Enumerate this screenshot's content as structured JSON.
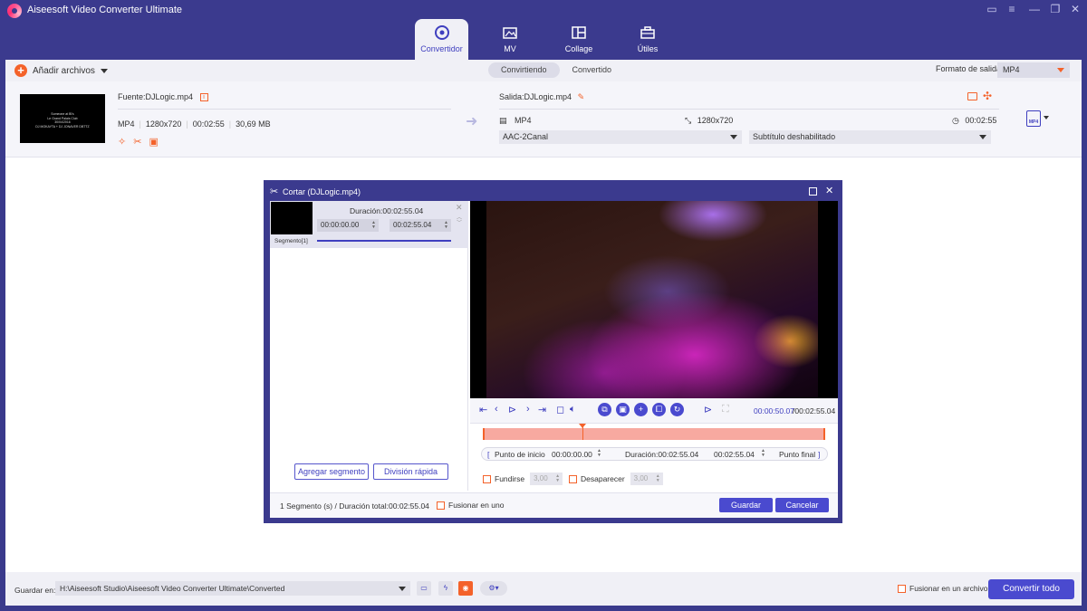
{
  "app": {
    "title": "Aiseesoft Video Converter Ultimate",
    "accent": "#4a4acf",
    "orange": "#f4622a"
  },
  "window_controls": [
    "chat-icon",
    "menu-icon",
    "minimize-icon",
    "maximize-icon",
    "close-icon"
  ],
  "nav_tabs": [
    {
      "label": "Convertidor",
      "icon": "convert-icon",
      "active": true
    },
    {
      "label": "MV",
      "icon": "mv-icon",
      "active": false
    },
    {
      "label": "Collage",
      "icon": "collage-icon",
      "active": false
    },
    {
      "label": "Útiles",
      "icon": "toolbox-icon",
      "active": false
    }
  ],
  "toolbar": {
    "add_files": "Añadir archivos",
    "subtabs": [
      "Convirtiendo",
      "Convertido"
    ],
    "output_format_label": "Formato de salida:",
    "output_format_value": "MP4"
  },
  "file": {
    "thumb_lines": [
      "Someone at Bl's",
      "Le Grand Palais Club",
      "30/04/2016",
      "DJ MOKAYTA + DJ JONAVER DBTTZ"
    ],
    "source_name": "Fuente:DJLogic.mp4",
    "source_format": "MP4",
    "source_resolution": "1280x720",
    "source_duration": "00:02:55",
    "source_size": "30,69 MB",
    "output_name": "Salida:DJLogic.mp4",
    "output_format": "MP4",
    "output_resolution": "1280x720",
    "output_duration": "00:02:55",
    "audio": "AAC-2Canal",
    "subtitle": "Subtítulo deshabilitado",
    "format_badge": "MP4"
  },
  "cut_dialog": {
    "title": "Cortar (DJLogic.mp4)",
    "segment": {
      "duration": "Duración:00:02:55.04",
      "start": "00:00:00.00",
      "end": "00:02:55.04",
      "label": "Segmento[1]"
    },
    "add_segment": "Agregar segmento",
    "quick_split": "División rápida",
    "time_current": "00:00:50.07",
    "time_total": "/00:02:55.04",
    "start_point_label": "Punto de inicio",
    "start_point": "00:00:00.00",
    "range_duration": "Duración:00:02:55.04",
    "end_point": "00:02:55.04",
    "end_point_label": "Punto final",
    "fade_in_label": "Fundirse",
    "fade_in_value": "3,00",
    "fade_out_label": "Desaparecer",
    "fade_out_value": "3,00",
    "summary": "1 Segmento (s) / Duración total:00:02:55.04",
    "merge_label": "Fusionar en uno",
    "save": "Guardar",
    "cancel": "Cancelar"
  },
  "bottom": {
    "save_to": "Guardar en:",
    "path": "H:\\Aiseesoft Studio\\Aiseesoft Video Converter Ultimate\\Converted",
    "merge_file": "Fusionar en un archivo",
    "convert_all": "Convertir todo"
  }
}
